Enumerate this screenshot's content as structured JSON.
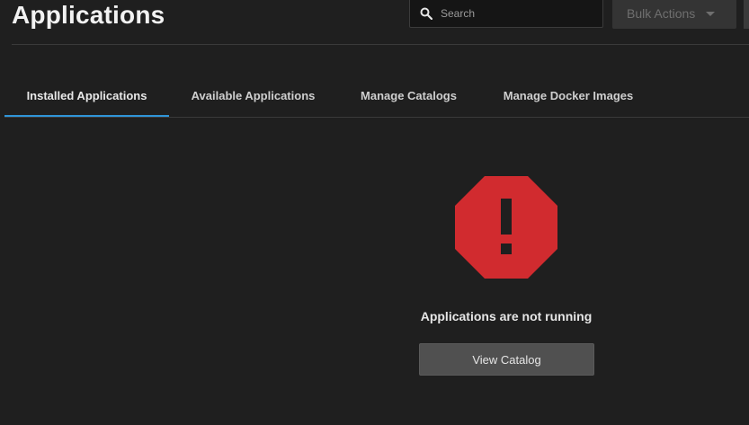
{
  "header": {
    "title": "Applications",
    "search": {
      "placeholder": "Search",
      "icon": "search-icon"
    },
    "bulk_actions_label": "Bulk Actions"
  },
  "tabs": [
    {
      "label": "Installed Applications",
      "active": true
    },
    {
      "label": "Available Applications",
      "active": false
    },
    {
      "label": "Manage Catalogs",
      "active": false
    },
    {
      "label": "Manage Docker Images",
      "active": false
    }
  ],
  "empty_state": {
    "icon": "stop-alert-icon",
    "icon_color": "#d12b2f",
    "message": "Applications are not running",
    "action_label": "View Catalog"
  },
  "colors": {
    "accent": "#2f95d8",
    "background": "#1f1f1f"
  }
}
